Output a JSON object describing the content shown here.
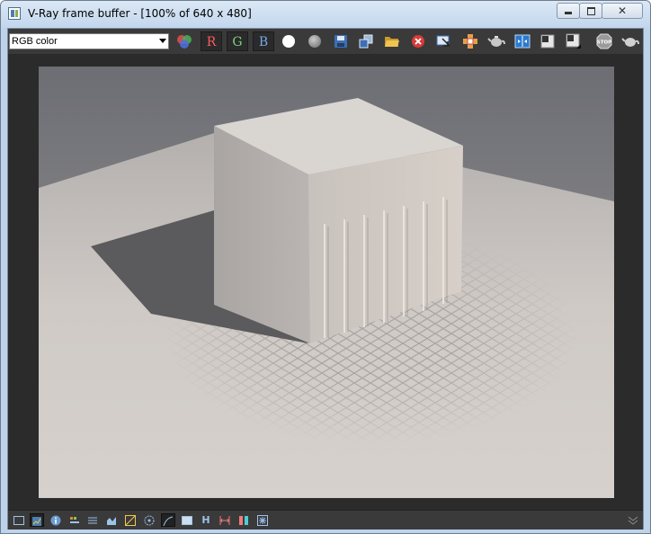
{
  "window": {
    "title": "V-Ray frame buffer - [100% of 640 x 480]"
  },
  "toolbar": {
    "channel": "RGB color",
    "r_label": "R",
    "g_label": "G",
    "b_label": "B",
    "stop_label": "STOP"
  },
  "statusbar": {
    "h_label": "H"
  },
  "icons": [
    "display-channels-icon",
    "white-circle-icon",
    "gray-circle-icon",
    "save-icon",
    "clone-icon",
    "open-icon",
    "clear-icon",
    "track-mouse-icon",
    "region-render-icon",
    "render-icon",
    "compare-icon",
    "ab-a-icon",
    "ab-b-icon",
    "stop-icon",
    "teapot-icon"
  ]
}
